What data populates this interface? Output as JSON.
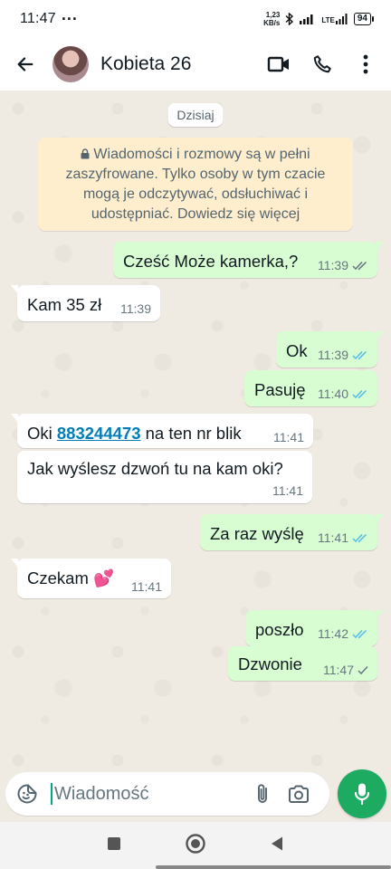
{
  "status_bar": {
    "time": "11:47",
    "more": "···",
    "speed_value": "1,23",
    "speed_unit": "KB/s",
    "network": "LTE",
    "battery": "94"
  },
  "header": {
    "contact_name": "Kobieta 26",
    "icons": [
      "back-arrow-icon",
      "video-call-icon",
      "phone-icon",
      "more-vert-icon"
    ]
  },
  "chat": {
    "date_label": "Dzisiaj",
    "encryption_notice": "Wiadomości i rozmowy są w pełni zaszyfrowane. Tylko osoby w tym czacie mogą je odczytywać, odsłuchiwać i udostępniać.",
    "learn_more": "Dowiedz się więcej",
    "messages": [
      {
        "dir": "out",
        "text": "Cześć Może kamerka,?",
        "time": "11:39",
        "status": "delivered"
      },
      {
        "dir": "in",
        "text": "Kam 35 zł",
        "time": "11:39"
      },
      {
        "dir": "out",
        "text": "Ok",
        "time": "11:39",
        "status": "read"
      },
      {
        "dir": "out",
        "text": "Pasuję",
        "time": "11:40",
        "status": "read"
      },
      {
        "dir": "in",
        "text_pre": "Oki",
        "link": "883244473",
        "text_post": "na ten nr blik",
        "time": "11:41"
      },
      {
        "dir": "in",
        "text": "Jak wyślesz dzwoń tu na kam oki?",
        "time": "11:41"
      },
      {
        "dir": "out",
        "text": "Za raz wyślę",
        "time": "11:41",
        "status": "read"
      },
      {
        "dir": "in",
        "text": "Czekam",
        "emoji": "💕",
        "time": "11:41"
      },
      {
        "dir": "out",
        "text": "poszło",
        "time": "11:42",
        "status": "read"
      },
      {
        "dir": "out",
        "text": "Dzwonie",
        "time": "11:47",
        "status": "sent"
      }
    ]
  },
  "composer": {
    "placeholder": "Wiadomość"
  },
  "colors": {
    "chat_bg": "#efeae2",
    "outgoing_bubble": "#d9fdd3",
    "incoming_bubble": "#ffffff",
    "read_tick": "#53bdeb",
    "mic_button": "#1daa61",
    "link": "#027eb5"
  }
}
